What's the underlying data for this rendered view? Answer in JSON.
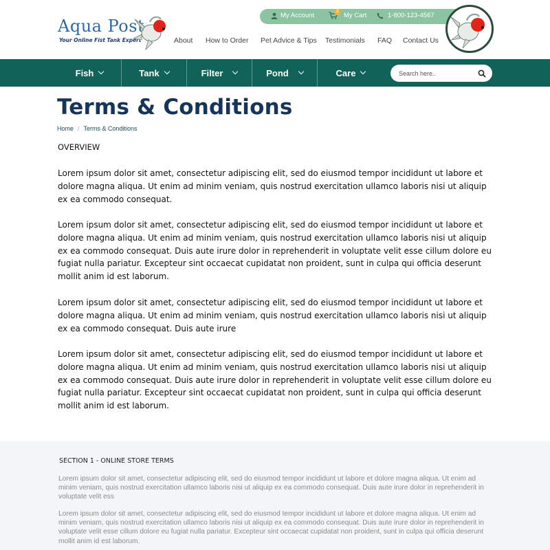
{
  "brand": {
    "name": "Aqua Post",
    "tagline": "Your Online Fist Tank Expert"
  },
  "topbar": {
    "account_label": "My Account",
    "cart_label": "My Cart",
    "cart_count": "3",
    "phone": "1-800-123-4567",
    "color": "#8cc4a2"
  },
  "top_nav": {
    "items": [
      "About",
      "How to Order",
      "Pet Advice & Tips",
      "Testimonials",
      "FAQ",
      "Contact Us"
    ]
  },
  "main_nav": {
    "color": "#11635a",
    "items": [
      {
        "label": "Fish"
      },
      {
        "label": "Tank"
      },
      {
        "label": "Filter"
      },
      {
        "label": "Pond"
      },
      {
        "label": "Care"
      }
    ]
  },
  "search": {
    "placeholder": "Search here.."
  },
  "page": {
    "title": "Terms & Conditions",
    "breadcrumb": [
      "Home",
      "Terms & Conditions"
    ],
    "overview_heading": "OVERVIEW",
    "paragraphs": [
      "Lorem ipsum dolor sit amet, consectetur adipiscing elit, sed do eiusmod tempor incididunt ut labore et dolore magna aliqua. Ut enim ad minim veniam, quis nostrud exercitation ullamco laboris nisi ut aliquip ex ea commodo consequat.",
      "Lorem ipsum dolor sit amet, consectetur adipiscing elit, sed do eiusmod tempor incididunt ut labore et dolore magna aliqua. Ut enim ad minim veniam, quis nostrud exercitation ullamco laboris nisi ut aliquip ex ea commodo consequat. Duis aute irure dolor in reprehenderit in voluptate velit esse cillum dolore eu fugiat nulla pariatur. Excepteur sint occaecat cupidatat non proident, sunt in culpa qui officia deserunt mollit anim id est laborum.",
      "Lorem ipsum dolor sit amet, consectetur adipiscing elit, sed do eiusmod tempor incididunt ut labore et dolore magna aliqua. Ut enim ad minim veniam, quis nostrud exercitation ullamco laboris nisi ut aliquip ex ea commodo consequat. Duis aute irure",
      "Lorem ipsum dolor sit amet, consectetur adipiscing elit, sed do eiusmod tempor incididunt ut labore et dolore magna aliqua. Ut enim ad minim veniam, quis nostrud exercitation ullamco laboris nisi ut aliquip ex ea commodo consequat. Duis aute irure dolor in reprehenderit in voluptate velit esse cillum dolore eu fugiat nulla pariatur. Excepteur sint occaecat cupidatat non proident, sunt in culpa qui officia deserunt mollit anim id est laborum."
    ]
  },
  "section1": {
    "title": "SECTION 1 - ONLINE STORE TERMS",
    "paragraphs": [
      "Lorem ipsum dolor sit amet, consectetur adipiscing elit, sed do eiusmod tempor incididunt ut labore et dolore magna aliqua. Ut enim ad minim veniam, quis nostrud exercitation ullamco laboris nisi ut aliquip ex ea commodo consequat. Duis aute irure dolor in reprehenderit in voluptate velit ess",
      "Lorem ipsum dolor sit amet, consectetur adipiscing elit, sed do eiusmod tempor incididunt ut labore et dolore magna aliqua. Ut enim ad minim veniam, quis nostrud exercitation ullamco laboris nisi ut aliquip ex ea commodo consequat. Duis aute irure dolor in reprehenderit in voluptate velit esse cillum dolore eu fugiat nulla pariatur. Excepteur sint occaecat cupidatat non proident, sunt in culpa qui officia deserunt mollit anim id est laborum."
    ]
  }
}
